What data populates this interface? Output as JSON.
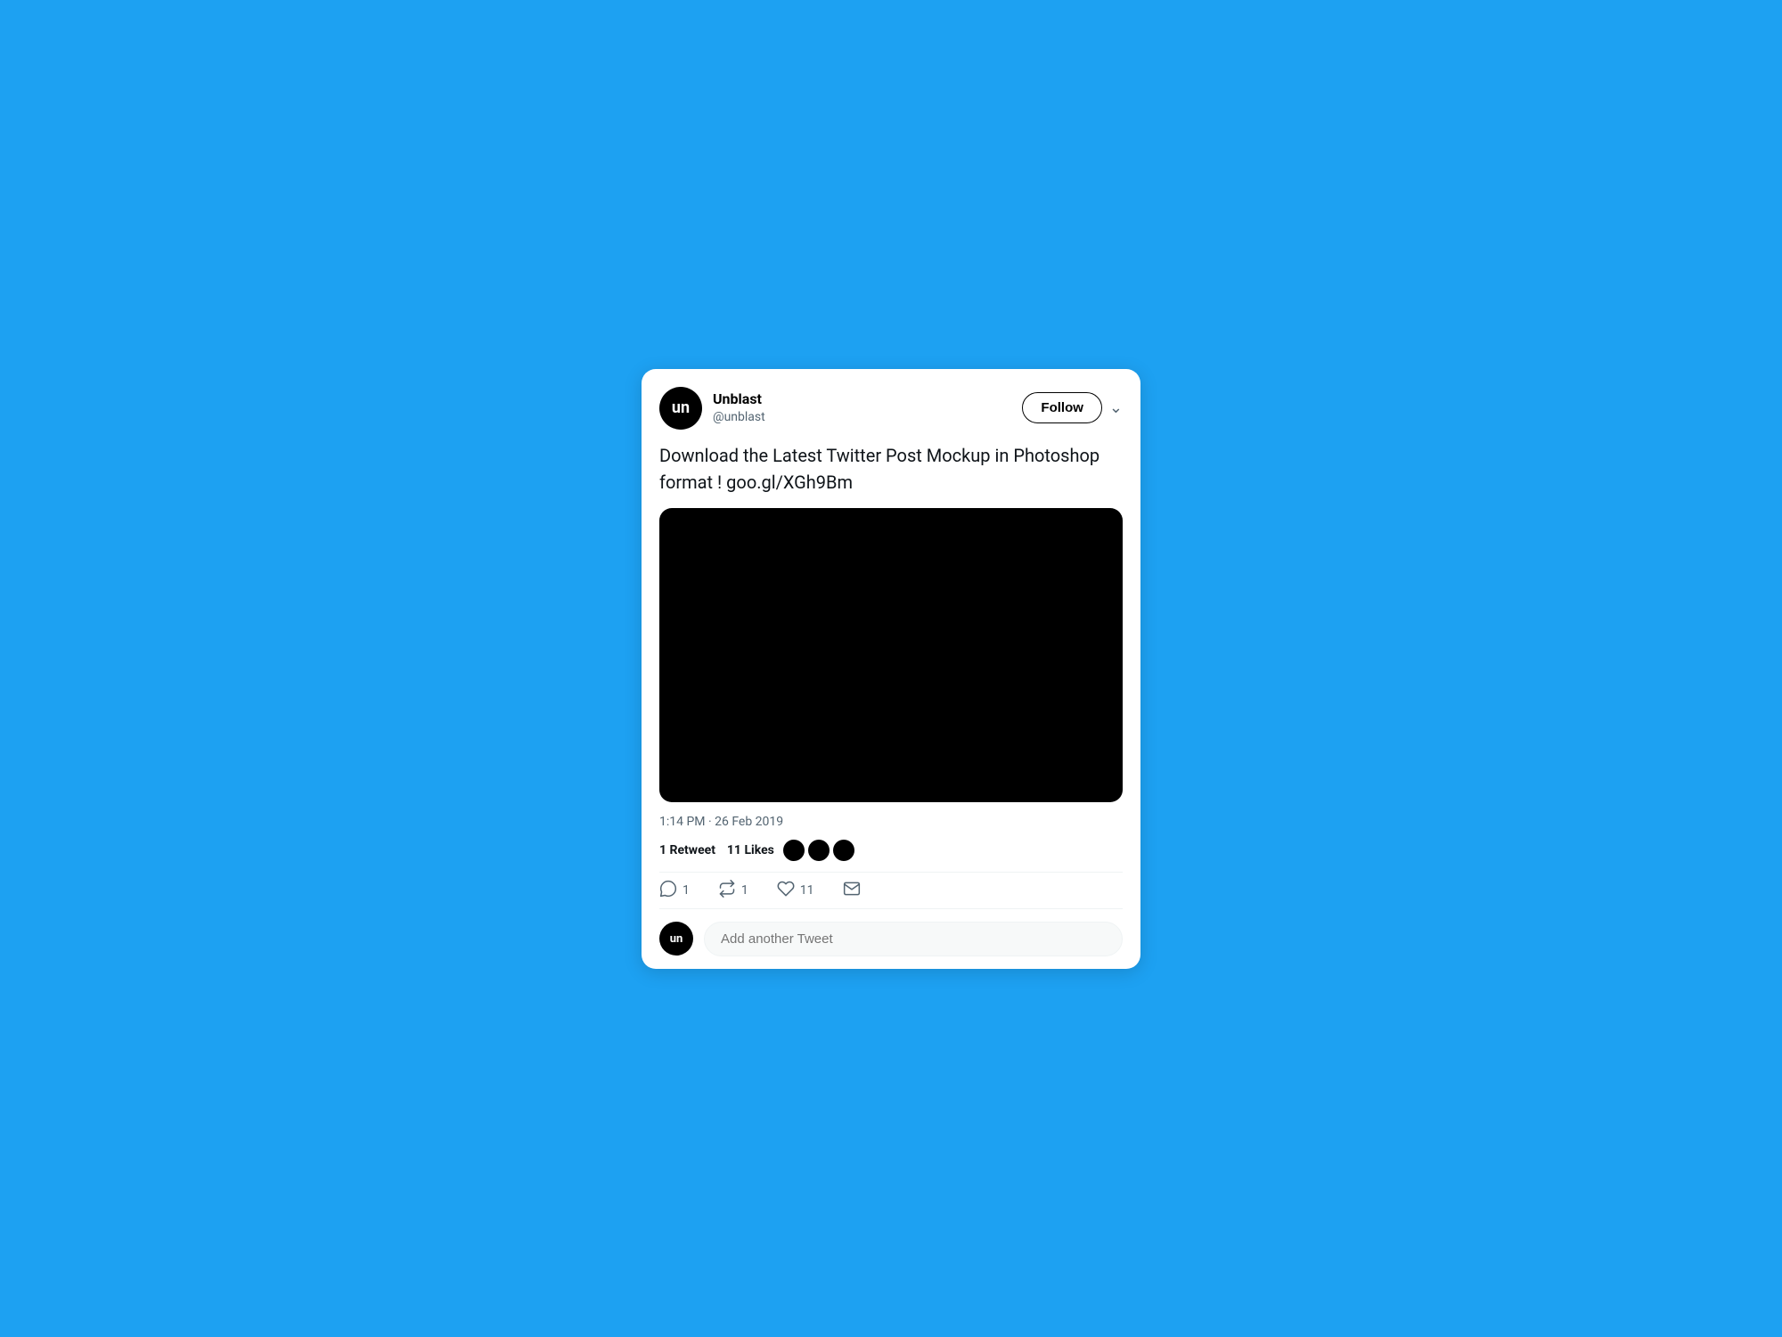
{
  "background": {
    "color": "#1DA1F2"
  },
  "tweet": {
    "user": {
      "display_name": "Unblast",
      "username": "@unblast",
      "avatar_initials": "un"
    },
    "follow_button_label": "Follow",
    "text": "Download the Latest Twitter Post Mockup in Photoshop format ! goo.gl/XGh9Bm",
    "timestamp": "1:14 PM · 26 Feb 2019",
    "stats": {
      "retweets_count": "1",
      "retweets_label": "Retweet",
      "likes_count": "11",
      "likes_label": "Likes"
    },
    "actions": {
      "reply_count": "1",
      "retweet_count": "1",
      "like_count": "11"
    },
    "reply_placeholder": "Add another Tweet"
  }
}
